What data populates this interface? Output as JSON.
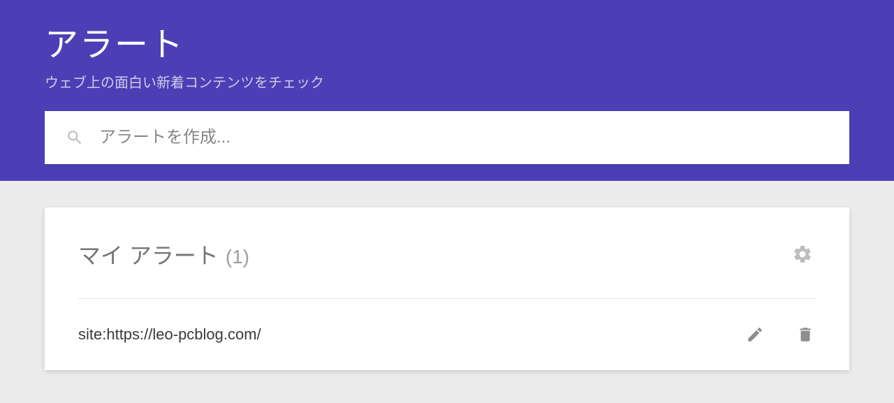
{
  "header": {
    "title": "アラート",
    "subtitle": "ウェブ上の面白い新着コンテンツをチェック"
  },
  "search": {
    "placeholder": "アラートを作成...",
    "value": ""
  },
  "myAlerts": {
    "title": "マイ アラート",
    "countDisplay": "(1)",
    "items": [
      {
        "query": "site:https://leo-pcblog.com/"
      }
    ]
  }
}
